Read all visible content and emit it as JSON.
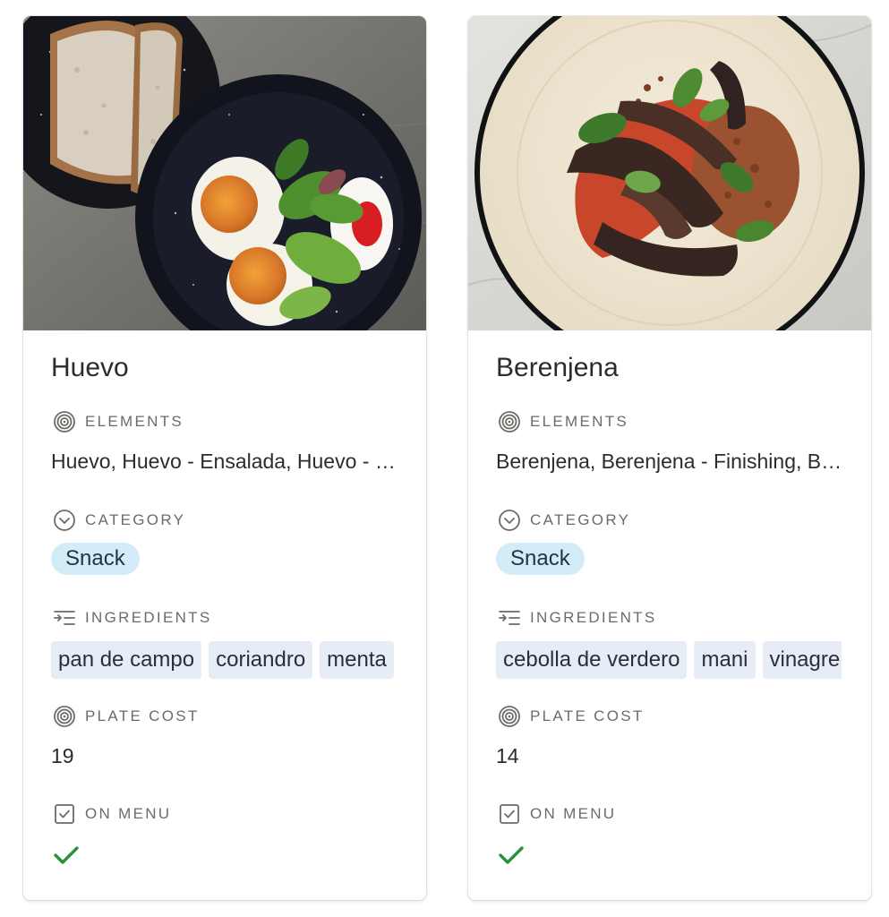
{
  "labels": {
    "elements": "ELEMENTS",
    "category": "CATEGORY",
    "ingredients": "INGREDIENTS",
    "plate_cost": "PLATE COST",
    "on_menu": "ON MENU"
  },
  "colors": {
    "category_pill_bg": "#d3ecf8",
    "ingredient_tag_bg": "#e7edf7",
    "check_green": "#27913b",
    "label_gray": "#6d6b66"
  },
  "icons": {
    "elements": "spiral-relation-icon",
    "category": "chevron-circle-icon",
    "ingredients": "multi-select-list-icon",
    "plate_cost": "spiral-formula-icon",
    "on_menu": "checkbox-icon",
    "on_menu_value": "checkmark-icon"
  },
  "cards": [
    {
      "title": "Huevo",
      "cover": "fried eggs with salad and red sauce on a speckled black enamel plate, sliced sourdough bread",
      "elements": "Huevo, Huevo - Ensalada, Huevo - Finishing",
      "category": "Snack",
      "ingredients": [
        "pan de campo",
        "coriandro",
        "menta"
      ],
      "plate_cost": "19",
      "on_menu": true
    },
    {
      "title": "Berenjena",
      "cover": "roasted eggplant with basil, red sauce and crumble on a cream enamel plate",
      "elements": "Berenjena, Berenjena - Finishing, Berenjena - Salsa",
      "category": "Snack",
      "ingredients": [
        "cebolla de verdero",
        "mani",
        "vinagre"
      ],
      "plate_cost": "14",
      "on_menu": true
    }
  ]
}
